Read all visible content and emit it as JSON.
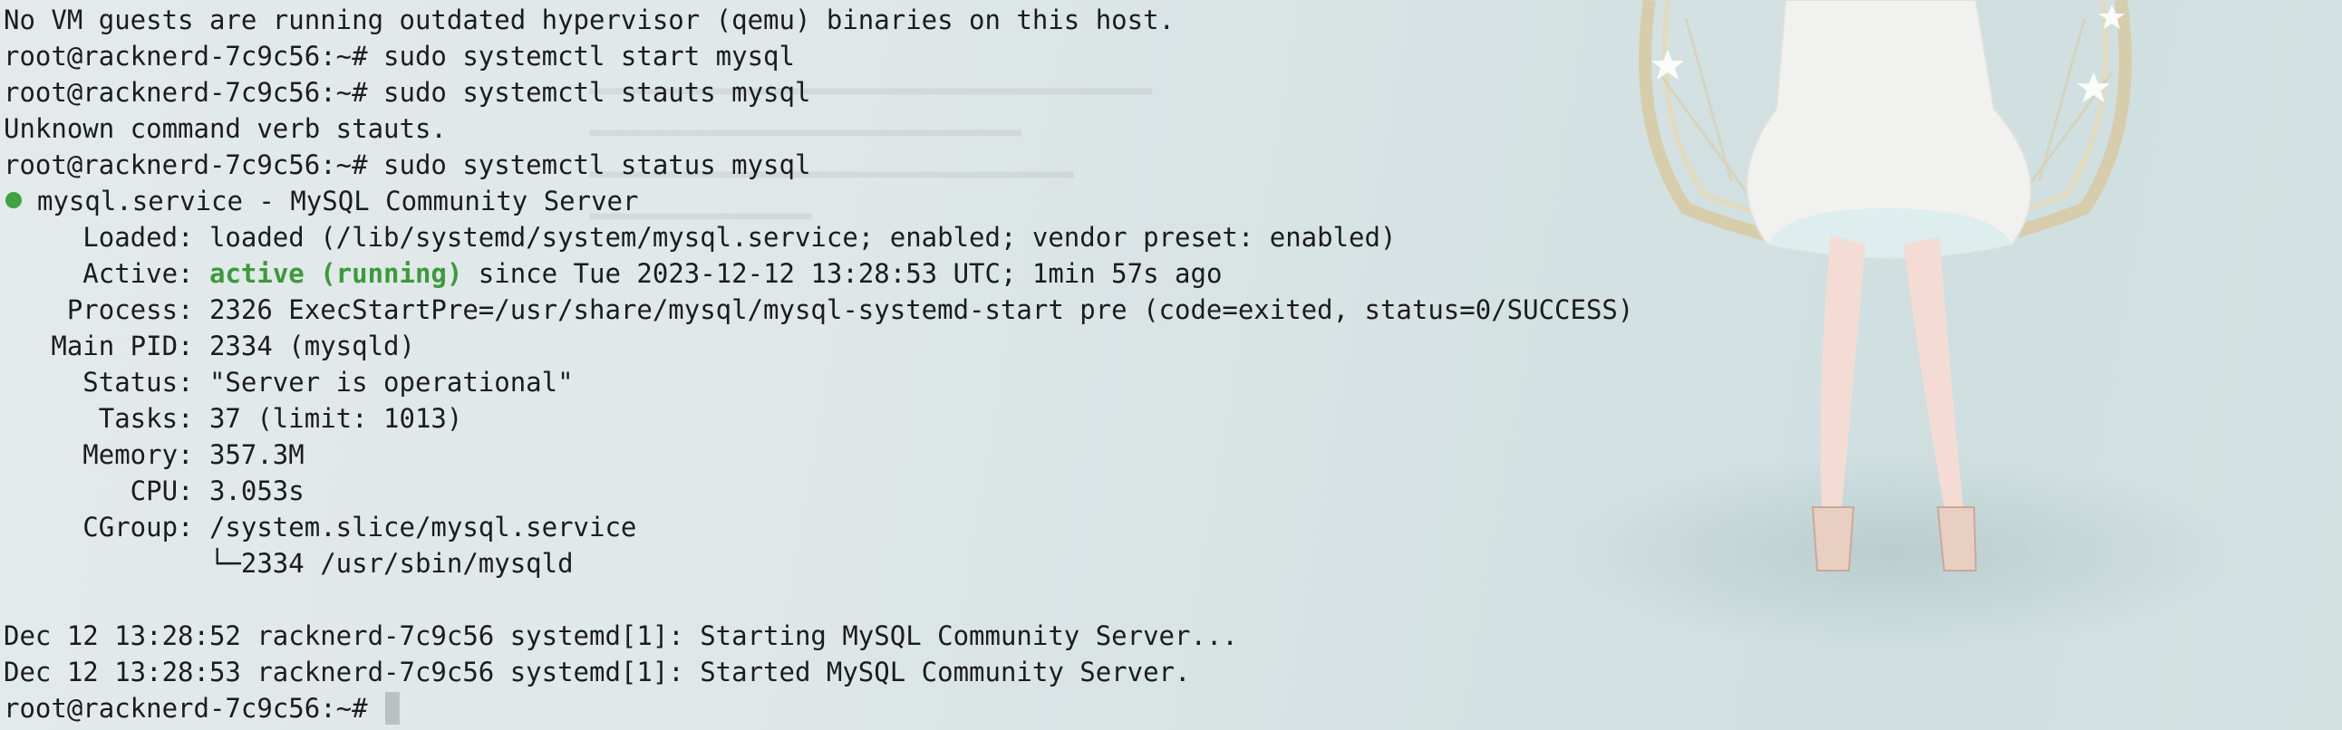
{
  "terminal": {
    "lines": [
      {
        "text": "No VM guests are running outdated hypervisor (qemu) binaries on this host."
      },
      {
        "prompt": "root@racknerd-7c9c56:~# ",
        "command": "sudo systemctl start mysql"
      },
      {
        "prompt": "root@racknerd-7c9c56:~# ",
        "command": "sudo systemctl stauts mysql"
      },
      {
        "text": "Unknown command verb stauts."
      },
      {
        "prompt": "root@racknerd-7c9c56:~# ",
        "command": "sudo systemctl status mysql"
      },
      {
        "text": "mysql.service - MySQL Community Server"
      },
      {
        "text": "     Loaded: loaded (/lib/systemd/system/mysql.service; enabled; vendor preset: enabled)"
      },
      {
        "pre": "     Active: ",
        "status": "active (running)",
        "post": " since Tue 2023-12-12 13:28:53 UTC; 1min 57s ago"
      },
      {
        "text": "    Process: 2326 ExecStartPre=/usr/share/mysql/mysql-systemd-start pre (code=exited, status=0/SUCCESS)"
      },
      {
        "text": "   Main PID: 2334 (mysqld)"
      },
      {
        "text": "     Status: \"Server is operational\""
      },
      {
        "text": "      Tasks: 37 (limit: 1013)"
      },
      {
        "text": "     Memory: 357.3M"
      },
      {
        "text": "        CPU: 3.053s"
      },
      {
        "text": "     CGroup: /system.slice/mysql.service"
      },
      {
        "text": "             └─2334 /usr/sbin/mysqld"
      },
      {
        "text": ""
      },
      {
        "text": "Dec 12 13:28:52 racknerd-7c9c56 systemd[1]: Starting MySQL Community Server..."
      },
      {
        "text": "Dec 12 13:28:53 racknerd-7c9c56 systemd[1]: Started MySQL Community Server."
      },
      {
        "prompt": "root@racknerd-7c9c56:~# ",
        "command": ""
      }
    ]
  },
  "colors": {
    "status_active": "#3b9a3b",
    "status_dot": "#3fa33f",
    "text": "#1c1c1c",
    "cursor": "#b9c1c3"
  },
  "icons": {
    "status_dot": "status-dot-icon",
    "cursor": "terminal-cursor-icon"
  }
}
